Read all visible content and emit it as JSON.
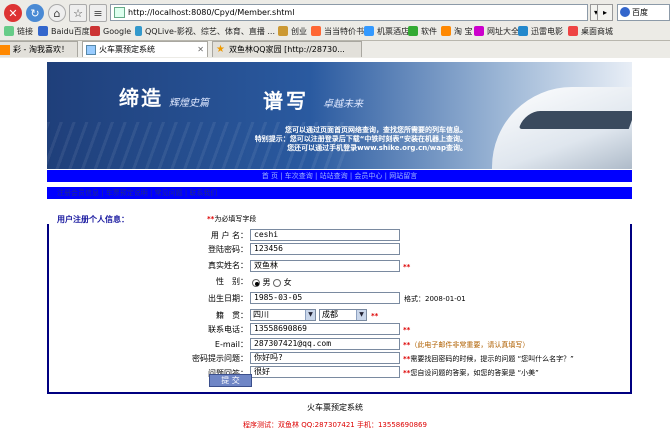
{
  "browser": {
    "address": "http://localhost:8080/Cpyd/Member.shtml",
    "go_label": "▸",
    "search_placeholder": "百度",
    "bookmarks": [
      "链接",
      "Baidu百度",
      "Google",
      "QQLive-影视、综艺、体育、直播 ...",
      "创业",
      "当当特价书",
      "机票酒店",
      "软件",
      "淘 宝",
      "网址大全",
      "迅雷电影",
      "桌面商城"
    ],
    "tabs": [
      "彩 - 淘我喜欢！",
      "火车票预定系统",
      "双鱼林QQ家园 [http://28730..."
    ]
  },
  "banner": {
    "title1": "缔造",
    "title_small1": "辉煌史篇",
    "title2": "谱写",
    "title_small2": "卓越未来",
    "notes": [
      "您可以通过页面首页网络查询，查找您所需要的列车信息。",
      "特别提示：您可以注册登录后下载“中铁时刻表”安装在机器上查询。",
      "您还可以通过手机登录www.shike.org.cn/wap查询。"
    ]
  },
  "nav": {
    "row1": "首 页 | 车次查询 | 站站查询 | 会员中心 | 网站留言",
    "row2": "注册会员信息 | 车票预定说明 | 常见问题 | 联系我们"
  },
  "form": {
    "heading": "用户注册个人信息：",
    "required_mark": "**",
    "required_note": "为必填写字段",
    "username_label": "用 户 名：",
    "username_value": "ceshi",
    "password_label": "登陆密码：",
    "password_value": "123456",
    "realname_label": "真实姓名：",
    "realname_value": "双鱼林",
    "gender_label": "性　别：",
    "gender_male": "男",
    "gender_female": "女",
    "birth_label": "出生日期：",
    "birth_value": "1985-03-05",
    "birth_format": "格式：2008-01-01",
    "native_label": "籍　贯：",
    "province": "四川",
    "city": "成都",
    "phone_label": "联系电话：",
    "phone_value": "13558690869",
    "email_label": "E-mail：",
    "email_value": "287307421@qq.com",
    "email_hint": "（此电子邮件非常重要，请认真填写）",
    "question_label": "密码提示问题：",
    "question_value": "你好吗?",
    "question_hint": "需要找回密码的时候，提示的问题 “您叫什么名字？”",
    "answer_label": "问题回答：",
    "answer_value": "很好",
    "answer_hint": "您自设问题的答案，如您的答案是 “小美”",
    "submit_label": "提 交"
  },
  "footer": {
    "system_name": "火车票预定系统",
    "credit": "程序测试：双鱼林 QQ:287307421 手机：13558690869"
  },
  "colors": {
    "nav_blue": "#0000ff",
    "required_red": "#dd0000",
    "heading_blue": "#1a1aa0"
  }
}
